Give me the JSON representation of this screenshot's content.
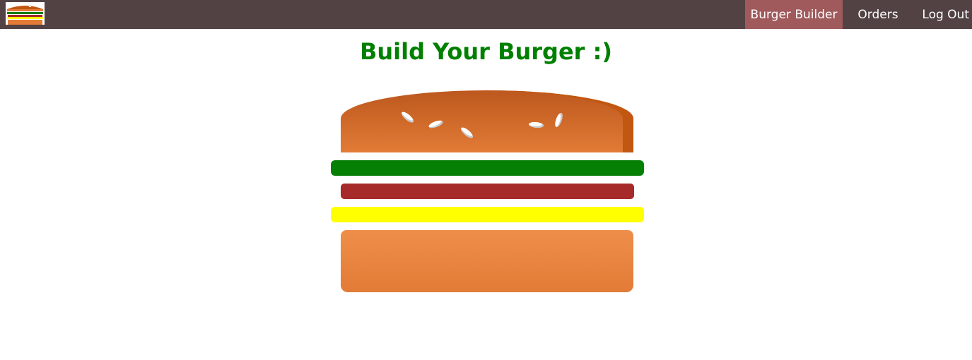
{
  "toolbar": {
    "logo_icon": "burger-logo-icon",
    "nav": [
      {
        "label": "Burger Builder",
        "active": true
      },
      {
        "label": "Orders",
        "active": false
      },
      {
        "label": "Log Out",
        "active": false
      }
    ]
  },
  "main": {
    "title": "Build Your Burger :)"
  },
  "burger": {
    "layers": [
      "bread-top",
      "salad",
      "meat",
      "cheese",
      "bread-bottom"
    ]
  },
  "colors": {
    "toolbar": "#524243",
    "nav_active": "#a05a5c",
    "title": "#008000",
    "salad": "#058005",
    "meat": "#a62a2a",
    "cheese": "#ffff00",
    "bread": "#e27b36"
  }
}
